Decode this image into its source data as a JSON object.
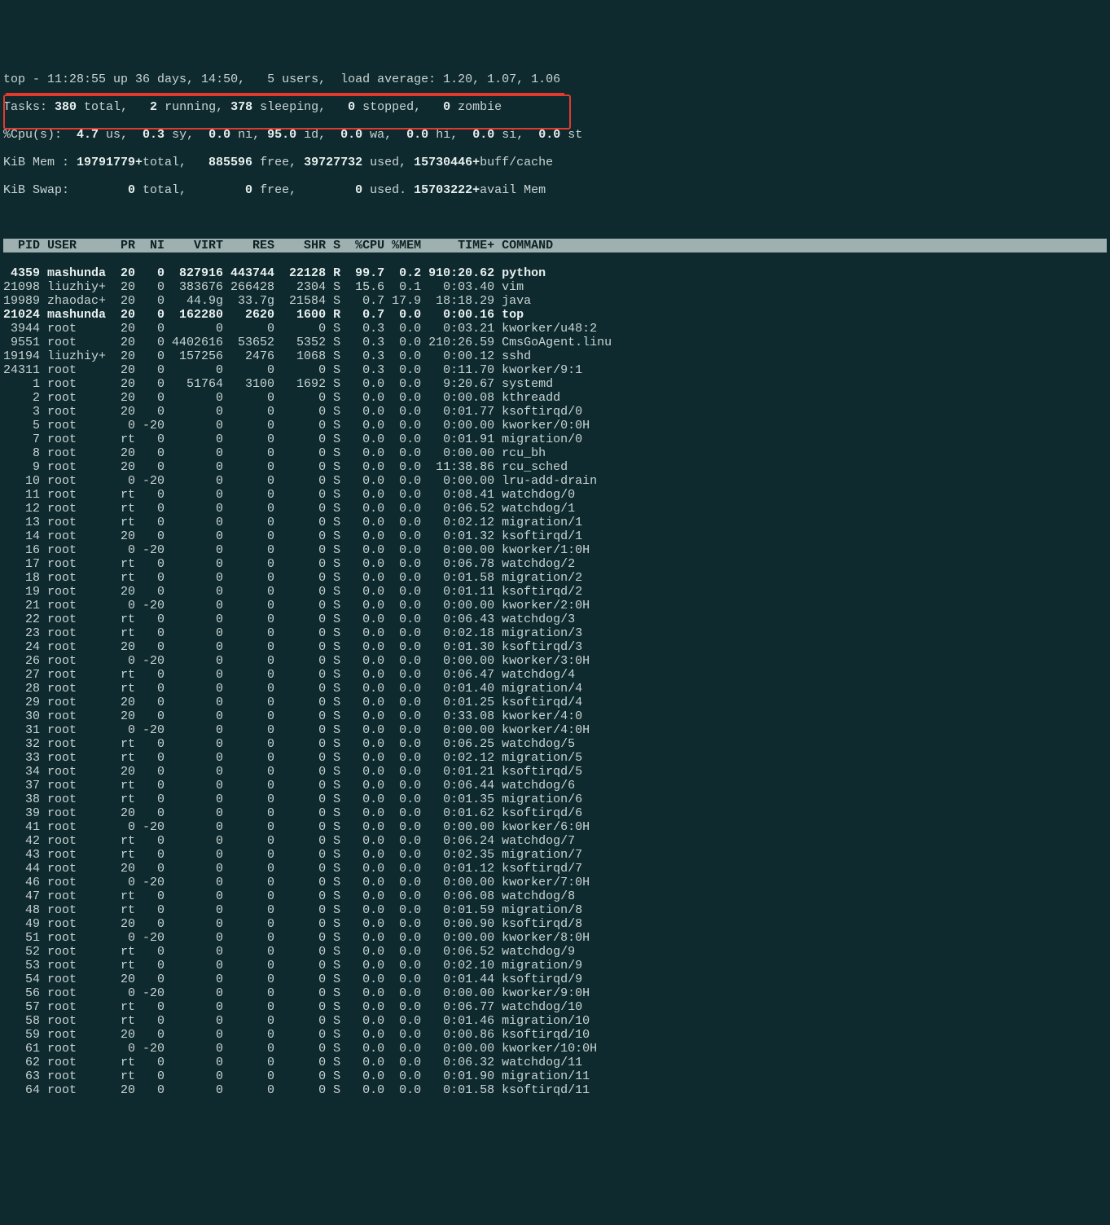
{
  "summary": {
    "line1_prefix": "top - ",
    "time": "11:28:55",
    "up_label": " up ",
    "uptime": "36 days, 14:50,",
    "users": "   5 users,",
    "load_label": "  load average: ",
    "load": "1.20, 1.07, 1.06",
    "tasks_label": "Tasks:",
    "tasks_total": " 380 ",
    "tasks_total_lbl": "total,",
    "tasks_running": "   2 ",
    "tasks_running_lbl": "running,",
    "tasks_sleeping": " 378 ",
    "tasks_sleeping_lbl": "sleeping,",
    "tasks_stopped": "   0 ",
    "tasks_stopped_lbl": "stopped,",
    "tasks_zombie": "   0 ",
    "tasks_zombie_lbl": "zombie",
    "cpu_label": "%Cpu(s):",
    "cpu_us": "  4.7 ",
    "cpu_us_lbl": "us,",
    "cpu_sy": "  0.3 ",
    "cpu_sy_lbl": "sy,",
    "cpu_ni": "  0.0 ",
    "cpu_ni_lbl": "ni,",
    "cpu_id": " 95.0 ",
    "cpu_id_lbl": "id,",
    "cpu_wa": "  0.0 ",
    "cpu_wa_lbl": "wa,",
    "cpu_hi": "  0.0 ",
    "cpu_hi_lbl": "hi,",
    "cpu_si": "  0.0 ",
    "cpu_si_lbl": "si,",
    "cpu_st": "  0.0 ",
    "cpu_st_lbl": "st",
    "mem_label": "KiB Mem :",
    "mem_total": " 19791779+",
    "mem_total_lbl": "total,",
    "mem_free": "   885596 ",
    "mem_free_lbl": "free,",
    "mem_used": " 39727732 ",
    "mem_used_lbl": "used,",
    "mem_buff": " 15730446+",
    "mem_buff_lbl": "buff/cache",
    "swap_label": "KiB Swap:",
    "swap_total": "        0 ",
    "swap_total_lbl": "total,",
    "swap_free": "        0 ",
    "swap_free_lbl": "free,",
    "swap_used": "        0 ",
    "swap_used_lbl": "used.",
    "swap_avail": " 15703222+",
    "swap_avail_lbl": "avail Mem"
  },
  "columns": "  PID USER      PR  NI    VIRT    RES    SHR S  %CPU %MEM     TIME+ COMMAND                                              ",
  "processes": [
    {
      "pid": " 4359",
      "user": "mashunda",
      "pr": "20",
      "ni": "  0",
      "virt": " 827916",
      "res": "443744",
      "shr": " 22128",
      "s": "R",
      "cpu": " 99.7",
      "mem": " 0.2",
      "time": "910:20.62",
      "cmd": "python",
      "bold": true
    },
    {
      "pid": "21098",
      "user": "liuzhiy+",
      "pr": "20",
      "ni": "  0",
      "virt": " 383676",
      "res": "266428",
      "shr": "  2304",
      "s": "S",
      "cpu": " 15.6",
      "mem": " 0.1",
      "time": "  0:03.40",
      "cmd": "vim",
      "bold": false
    },
    {
      "pid": "19989",
      "user": "zhaodac+",
      "pr": "20",
      "ni": "  0",
      "virt": "  44.9g",
      "res": " 33.7g",
      "shr": " 21584",
      "s": "S",
      "cpu": "  0.7",
      "mem": "17.9",
      "time": " 18:18.29",
      "cmd": "java",
      "bold": false
    },
    {
      "pid": "21024",
      "user": "mashunda",
      "pr": "20",
      "ni": "  0",
      "virt": " 162280",
      "res": "  2620",
      "shr": "  1600",
      "s": "R",
      "cpu": "  0.7",
      "mem": " 0.0",
      "time": "  0:00.16",
      "cmd": "top",
      "bold": true
    },
    {
      "pid": " 3944",
      "user": "root    ",
      "pr": "20",
      "ni": "  0",
      "virt": "      0",
      "res": "     0",
      "shr": "     0",
      "s": "S",
      "cpu": "  0.3",
      "mem": " 0.0",
      "time": "  0:03.21",
      "cmd": "kworker/u48:2",
      "bold": false
    },
    {
      "pid": " 9551",
      "user": "root    ",
      "pr": "20",
      "ni": "  0",
      "virt": "4402616",
      "res": " 53652",
      "shr": "  5352",
      "s": "S",
      "cpu": "  0.3",
      "mem": " 0.0",
      "time": "210:26.59",
      "cmd": "CmsGoAgent.linu",
      "bold": false
    },
    {
      "pid": "19194",
      "user": "liuzhiy+",
      "pr": "20",
      "ni": "  0",
      "virt": " 157256",
      "res": "  2476",
      "shr": "  1068",
      "s": "S",
      "cpu": "  0.3",
      "mem": " 0.0",
      "time": "  0:00.12",
      "cmd": "sshd",
      "bold": false
    },
    {
      "pid": "24311",
      "user": "root    ",
      "pr": "20",
      "ni": "  0",
      "virt": "      0",
      "res": "     0",
      "shr": "     0",
      "s": "S",
      "cpu": "  0.3",
      "mem": " 0.0",
      "time": "  0:11.70",
      "cmd": "kworker/9:1",
      "bold": false
    },
    {
      "pid": "    1",
      "user": "root    ",
      "pr": "20",
      "ni": "  0",
      "virt": "  51764",
      "res": "  3100",
      "shr": "  1692",
      "s": "S",
      "cpu": "  0.0",
      "mem": " 0.0",
      "time": "  9:20.67",
      "cmd": "systemd",
      "bold": false
    },
    {
      "pid": "    2",
      "user": "root    ",
      "pr": "20",
      "ni": "  0",
      "virt": "      0",
      "res": "     0",
      "shr": "     0",
      "s": "S",
      "cpu": "  0.0",
      "mem": " 0.0",
      "time": "  0:00.08",
      "cmd": "kthreadd",
      "bold": false
    },
    {
      "pid": "    3",
      "user": "root    ",
      "pr": "20",
      "ni": "  0",
      "virt": "      0",
      "res": "     0",
      "shr": "     0",
      "s": "S",
      "cpu": "  0.0",
      "mem": " 0.0",
      "time": "  0:01.77",
      "cmd": "ksoftirqd/0",
      "bold": false
    },
    {
      "pid": "    5",
      "user": "root    ",
      "pr": " 0",
      "ni": "-20",
      "virt": "      0",
      "res": "     0",
      "shr": "     0",
      "s": "S",
      "cpu": "  0.0",
      "mem": " 0.0",
      "time": "  0:00.00",
      "cmd": "kworker/0:0H",
      "bold": false
    },
    {
      "pid": "    7",
      "user": "root    ",
      "pr": "rt",
      "ni": "  0",
      "virt": "      0",
      "res": "     0",
      "shr": "     0",
      "s": "S",
      "cpu": "  0.0",
      "mem": " 0.0",
      "time": "  0:01.91",
      "cmd": "migration/0",
      "bold": false
    },
    {
      "pid": "    8",
      "user": "root    ",
      "pr": "20",
      "ni": "  0",
      "virt": "      0",
      "res": "     0",
      "shr": "     0",
      "s": "S",
      "cpu": "  0.0",
      "mem": " 0.0",
      "time": "  0:00.00",
      "cmd": "rcu_bh",
      "bold": false
    },
    {
      "pid": "    9",
      "user": "root    ",
      "pr": "20",
      "ni": "  0",
      "virt": "      0",
      "res": "     0",
      "shr": "     0",
      "s": "S",
      "cpu": "  0.0",
      "mem": " 0.0",
      "time": " 11:38.86",
      "cmd": "rcu_sched",
      "bold": false
    },
    {
      "pid": "   10",
      "user": "root    ",
      "pr": " 0",
      "ni": "-20",
      "virt": "      0",
      "res": "     0",
      "shr": "     0",
      "s": "S",
      "cpu": "  0.0",
      "mem": " 0.0",
      "time": "  0:00.00",
      "cmd": "lru-add-drain",
      "bold": false
    },
    {
      "pid": "   11",
      "user": "root    ",
      "pr": "rt",
      "ni": "  0",
      "virt": "      0",
      "res": "     0",
      "shr": "     0",
      "s": "S",
      "cpu": "  0.0",
      "mem": " 0.0",
      "time": "  0:08.41",
      "cmd": "watchdog/0",
      "bold": false
    },
    {
      "pid": "   12",
      "user": "root    ",
      "pr": "rt",
      "ni": "  0",
      "virt": "      0",
      "res": "     0",
      "shr": "     0",
      "s": "S",
      "cpu": "  0.0",
      "mem": " 0.0",
      "time": "  0:06.52",
      "cmd": "watchdog/1",
      "bold": false
    },
    {
      "pid": "   13",
      "user": "root    ",
      "pr": "rt",
      "ni": "  0",
      "virt": "      0",
      "res": "     0",
      "shr": "     0",
      "s": "S",
      "cpu": "  0.0",
      "mem": " 0.0",
      "time": "  0:02.12",
      "cmd": "migration/1",
      "bold": false
    },
    {
      "pid": "   14",
      "user": "root    ",
      "pr": "20",
      "ni": "  0",
      "virt": "      0",
      "res": "     0",
      "shr": "     0",
      "s": "S",
      "cpu": "  0.0",
      "mem": " 0.0",
      "time": "  0:01.32",
      "cmd": "ksoftirqd/1",
      "bold": false
    },
    {
      "pid": "   16",
      "user": "root    ",
      "pr": " 0",
      "ni": "-20",
      "virt": "      0",
      "res": "     0",
      "shr": "     0",
      "s": "S",
      "cpu": "  0.0",
      "mem": " 0.0",
      "time": "  0:00.00",
      "cmd": "kworker/1:0H",
      "bold": false
    },
    {
      "pid": "   17",
      "user": "root    ",
      "pr": "rt",
      "ni": "  0",
      "virt": "      0",
      "res": "     0",
      "shr": "     0",
      "s": "S",
      "cpu": "  0.0",
      "mem": " 0.0",
      "time": "  0:06.78",
      "cmd": "watchdog/2",
      "bold": false
    },
    {
      "pid": "   18",
      "user": "root    ",
      "pr": "rt",
      "ni": "  0",
      "virt": "      0",
      "res": "     0",
      "shr": "     0",
      "s": "S",
      "cpu": "  0.0",
      "mem": " 0.0",
      "time": "  0:01.58",
      "cmd": "migration/2",
      "bold": false
    },
    {
      "pid": "   19",
      "user": "root    ",
      "pr": "20",
      "ni": "  0",
      "virt": "      0",
      "res": "     0",
      "shr": "     0",
      "s": "S",
      "cpu": "  0.0",
      "mem": " 0.0",
      "time": "  0:01.11",
      "cmd": "ksoftirqd/2",
      "bold": false
    },
    {
      "pid": "   21",
      "user": "root    ",
      "pr": " 0",
      "ni": "-20",
      "virt": "      0",
      "res": "     0",
      "shr": "     0",
      "s": "S",
      "cpu": "  0.0",
      "mem": " 0.0",
      "time": "  0:00.00",
      "cmd": "kworker/2:0H",
      "bold": false
    },
    {
      "pid": "   22",
      "user": "root    ",
      "pr": "rt",
      "ni": "  0",
      "virt": "      0",
      "res": "     0",
      "shr": "     0",
      "s": "S",
      "cpu": "  0.0",
      "mem": " 0.0",
      "time": "  0:06.43",
      "cmd": "watchdog/3",
      "bold": false
    },
    {
      "pid": "   23",
      "user": "root    ",
      "pr": "rt",
      "ni": "  0",
      "virt": "      0",
      "res": "     0",
      "shr": "     0",
      "s": "S",
      "cpu": "  0.0",
      "mem": " 0.0",
      "time": "  0:02.18",
      "cmd": "migration/3",
      "bold": false
    },
    {
      "pid": "   24",
      "user": "root    ",
      "pr": "20",
      "ni": "  0",
      "virt": "      0",
      "res": "     0",
      "shr": "     0",
      "s": "S",
      "cpu": "  0.0",
      "mem": " 0.0",
      "time": "  0:01.30",
      "cmd": "ksoftirqd/3",
      "bold": false
    },
    {
      "pid": "   26",
      "user": "root    ",
      "pr": " 0",
      "ni": "-20",
      "virt": "      0",
      "res": "     0",
      "shr": "     0",
      "s": "S",
      "cpu": "  0.0",
      "mem": " 0.0",
      "time": "  0:00.00",
      "cmd": "kworker/3:0H",
      "bold": false
    },
    {
      "pid": "   27",
      "user": "root    ",
      "pr": "rt",
      "ni": "  0",
      "virt": "      0",
      "res": "     0",
      "shr": "     0",
      "s": "S",
      "cpu": "  0.0",
      "mem": " 0.0",
      "time": "  0:06.47",
      "cmd": "watchdog/4",
      "bold": false
    },
    {
      "pid": "   28",
      "user": "root    ",
      "pr": "rt",
      "ni": "  0",
      "virt": "      0",
      "res": "     0",
      "shr": "     0",
      "s": "S",
      "cpu": "  0.0",
      "mem": " 0.0",
      "time": "  0:01.40",
      "cmd": "migration/4",
      "bold": false
    },
    {
      "pid": "   29",
      "user": "root    ",
      "pr": "20",
      "ni": "  0",
      "virt": "      0",
      "res": "     0",
      "shr": "     0",
      "s": "S",
      "cpu": "  0.0",
      "mem": " 0.0",
      "time": "  0:01.25",
      "cmd": "ksoftirqd/4",
      "bold": false
    },
    {
      "pid": "   30",
      "user": "root    ",
      "pr": "20",
      "ni": "  0",
      "virt": "      0",
      "res": "     0",
      "shr": "     0",
      "s": "S",
      "cpu": "  0.0",
      "mem": " 0.0",
      "time": "  0:33.08",
      "cmd": "kworker/4:0",
      "bold": false
    },
    {
      "pid": "   31",
      "user": "root    ",
      "pr": " 0",
      "ni": "-20",
      "virt": "      0",
      "res": "     0",
      "shr": "     0",
      "s": "S",
      "cpu": "  0.0",
      "mem": " 0.0",
      "time": "  0:00.00",
      "cmd": "kworker/4:0H",
      "bold": false
    },
    {
      "pid": "   32",
      "user": "root    ",
      "pr": "rt",
      "ni": "  0",
      "virt": "      0",
      "res": "     0",
      "shr": "     0",
      "s": "S",
      "cpu": "  0.0",
      "mem": " 0.0",
      "time": "  0:06.25",
      "cmd": "watchdog/5",
      "bold": false
    },
    {
      "pid": "   33",
      "user": "root    ",
      "pr": "rt",
      "ni": "  0",
      "virt": "      0",
      "res": "     0",
      "shr": "     0",
      "s": "S",
      "cpu": "  0.0",
      "mem": " 0.0",
      "time": "  0:02.12",
      "cmd": "migration/5",
      "bold": false
    },
    {
      "pid": "   34",
      "user": "root    ",
      "pr": "20",
      "ni": "  0",
      "virt": "      0",
      "res": "     0",
      "shr": "     0",
      "s": "S",
      "cpu": "  0.0",
      "mem": " 0.0",
      "time": "  0:01.21",
      "cmd": "ksoftirqd/5",
      "bold": false
    },
    {
      "pid": "   37",
      "user": "root    ",
      "pr": "rt",
      "ni": "  0",
      "virt": "      0",
      "res": "     0",
      "shr": "     0",
      "s": "S",
      "cpu": "  0.0",
      "mem": " 0.0",
      "time": "  0:06.44",
      "cmd": "watchdog/6",
      "bold": false
    },
    {
      "pid": "   38",
      "user": "root    ",
      "pr": "rt",
      "ni": "  0",
      "virt": "      0",
      "res": "     0",
      "shr": "     0",
      "s": "S",
      "cpu": "  0.0",
      "mem": " 0.0",
      "time": "  0:01.35",
      "cmd": "migration/6",
      "bold": false
    },
    {
      "pid": "   39",
      "user": "root    ",
      "pr": "20",
      "ni": "  0",
      "virt": "      0",
      "res": "     0",
      "shr": "     0",
      "s": "S",
      "cpu": "  0.0",
      "mem": " 0.0",
      "time": "  0:01.62",
      "cmd": "ksoftirqd/6",
      "bold": false
    },
    {
      "pid": "   41",
      "user": "root    ",
      "pr": " 0",
      "ni": "-20",
      "virt": "      0",
      "res": "     0",
      "shr": "     0",
      "s": "S",
      "cpu": "  0.0",
      "mem": " 0.0",
      "time": "  0:00.00",
      "cmd": "kworker/6:0H",
      "bold": false
    },
    {
      "pid": "   42",
      "user": "root    ",
      "pr": "rt",
      "ni": "  0",
      "virt": "      0",
      "res": "     0",
      "shr": "     0",
      "s": "S",
      "cpu": "  0.0",
      "mem": " 0.0",
      "time": "  0:06.24",
      "cmd": "watchdog/7",
      "bold": false
    },
    {
      "pid": "   43",
      "user": "root    ",
      "pr": "rt",
      "ni": "  0",
      "virt": "      0",
      "res": "     0",
      "shr": "     0",
      "s": "S",
      "cpu": "  0.0",
      "mem": " 0.0",
      "time": "  0:02.35",
      "cmd": "migration/7",
      "bold": false
    },
    {
      "pid": "   44",
      "user": "root    ",
      "pr": "20",
      "ni": "  0",
      "virt": "      0",
      "res": "     0",
      "shr": "     0",
      "s": "S",
      "cpu": "  0.0",
      "mem": " 0.0",
      "time": "  0:01.12",
      "cmd": "ksoftirqd/7",
      "bold": false
    },
    {
      "pid": "   46",
      "user": "root    ",
      "pr": " 0",
      "ni": "-20",
      "virt": "      0",
      "res": "     0",
      "shr": "     0",
      "s": "S",
      "cpu": "  0.0",
      "mem": " 0.0",
      "time": "  0:00.00",
      "cmd": "kworker/7:0H",
      "bold": false
    },
    {
      "pid": "   47",
      "user": "root    ",
      "pr": "rt",
      "ni": "  0",
      "virt": "      0",
      "res": "     0",
      "shr": "     0",
      "s": "S",
      "cpu": "  0.0",
      "mem": " 0.0",
      "time": "  0:06.08",
      "cmd": "watchdog/8",
      "bold": false
    },
    {
      "pid": "   48",
      "user": "root    ",
      "pr": "rt",
      "ni": "  0",
      "virt": "      0",
      "res": "     0",
      "shr": "     0",
      "s": "S",
      "cpu": "  0.0",
      "mem": " 0.0",
      "time": "  0:01.59",
      "cmd": "migration/8",
      "bold": false
    },
    {
      "pid": "   49",
      "user": "root    ",
      "pr": "20",
      "ni": "  0",
      "virt": "      0",
      "res": "     0",
      "shr": "     0",
      "s": "S",
      "cpu": "  0.0",
      "mem": " 0.0",
      "time": "  0:00.90",
      "cmd": "ksoftirqd/8",
      "bold": false
    },
    {
      "pid": "   51",
      "user": "root    ",
      "pr": " 0",
      "ni": "-20",
      "virt": "      0",
      "res": "     0",
      "shr": "     0",
      "s": "S",
      "cpu": "  0.0",
      "mem": " 0.0",
      "time": "  0:00.00",
      "cmd": "kworker/8:0H",
      "bold": false
    },
    {
      "pid": "   52",
      "user": "root    ",
      "pr": "rt",
      "ni": "  0",
      "virt": "      0",
      "res": "     0",
      "shr": "     0",
      "s": "S",
      "cpu": "  0.0",
      "mem": " 0.0",
      "time": "  0:06.52",
      "cmd": "watchdog/9",
      "bold": false
    },
    {
      "pid": "   53",
      "user": "root    ",
      "pr": "rt",
      "ni": "  0",
      "virt": "      0",
      "res": "     0",
      "shr": "     0",
      "s": "S",
      "cpu": "  0.0",
      "mem": " 0.0",
      "time": "  0:02.10",
      "cmd": "migration/9",
      "bold": false
    },
    {
      "pid": "   54",
      "user": "root    ",
      "pr": "20",
      "ni": "  0",
      "virt": "      0",
      "res": "     0",
      "shr": "     0",
      "s": "S",
      "cpu": "  0.0",
      "mem": " 0.0",
      "time": "  0:01.44",
      "cmd": "ksoftirqd/9",
      "bold": false
    },
    {
      "pid": "   56",
      "user": "root    ",
      "pr": " 0",
      "ni": "-20",
      "virt": "      0",
      "res": "     0",
      "shr": "     0",
      "s": "S",
      "cpu": "  0.0",
      "mem": " 0.0",
      "time": "  0:00.00",
      "cmd": "kworker/9:0H",
      "bold": false
    },
    {
      "pid": "   57",
      "user": "root    ",
      "pr": "rt",
      "ni": "  0",
      "virt": "      0",
      "res": "     0",
      "shr": "     0",
      "s": "S",
      "cpu": "  0.0",
      "mem": " 0.0",
      "time": "  0:06.77",
      "cmd": "watchdog/10",
      "bold": false
    },
    {
      "pid": "   58",
      "user": "root    ",
      "pr": "rt",
      "ni": "  0",
      "virt": "      0",
      "res": "     0",
      "shr": "     0",
      "s": "S",
      "cpu": "  0.0",
      "mem": " 0.0",
      "time": "  0:01.46",
      "cmd": "migration/10",
      "bold": false
    },
    {
      "pid": "   59",
      "user": "root    ",
      "pr": "20",
      "ni": "  0",
      "virt": "      0",
      "res": "     0",
      "shr": "     0",
      "s": "S",
      "cpu": "  0.0",
      "mem": " 0.0",
      "time": "  0:00.86",
      "cmd": "ksoftirqd/10",
      "bold": false
    },
    {
      "pid": "   61",
      "user": "root    ",
      "pr": " 0",
      "ni": "-20",
      "virt": "      0",
      "res": "     0",
      "shr": "     0",
      "s": "S",
      "cpu": "  0.0",
      "mem": " 0.0",
      "time": "  0:00.00",
      "cmd": "kworker/10:0H",
      "bold": false
    },
    {
      "pid": "   62",
      "user": "root    ",
      "pr": "rt",
      "ni": "  0",
      "virt": "      0",
      "res": "     0",
      "shr": "     0",
      "s": "S",
      "cpu": "  0.0",
      "mem": " 0.0",
      "time": "  0:06.32",
      "cmd": "watchdog/11",
      "bold": false
    },
    {
      "pid": "   63",
      "user": "root    ",
      "pr": "rt",
      "ni": "  0",
      "virt": "      0",
      "res": "     0",
      "shr": "     0",
      "s": "S",
      "cpu": "  0.0",
      "mem": " 0.0",
      "time": "  0:01.90",
      "cmd": "migration/11",
      "bold": false
    },
    {
      "pid": "   64",
      "user": "root    ",
      "pr": "20",
      "ni": "  0",
      "virt": "      0",
      "res": "     0",
      "shr": "     0",
      "s": "S",
      "cpu": "  0.0",
      "mem": " 0.0",
      "time": "  0:01.58",
      "cmd": "ksoftirqd/11",
      "bold": false
    }
  ]
}
